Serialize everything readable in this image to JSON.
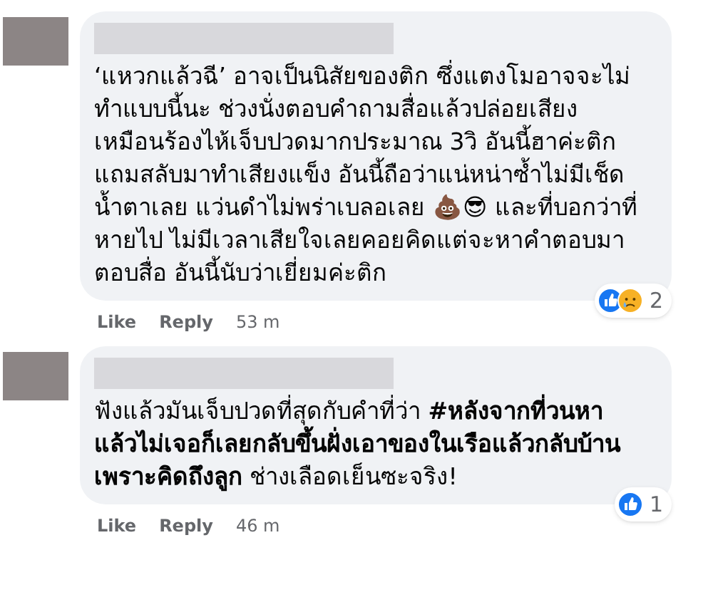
{
  "comments": [
    {
      "text": "‘แหวกแล้วฉี’ อาจเป็นนิสัยของติก ซึ่งแตงโมอาจจะไม่ทำแบบนี้นะ ช่วงนั่งตอบคำถามสื่อแล้วปล่อยเสียงเหมือนร้องไห้เจ็บปวดมากประมาณ 3วิ อันนี้ฮาค่ะติก แถมสลับมาทำเสียงแข็ง อันนี้ถือว่าแน่หน่าซ้ำไม่มีเช็ดน้ำตาเลย แว่นดำไม่พร่าเบลอเลย 💩😎 และที่บอกว่าที่หายไป ไม่มีเวลาเสียใจเลยคอยคิดแต่จะหาคำตอบมาตอบสื่อ อันนี้นับว่าเยี่ยมค่ะติก",
      "reactions": [
        {
          "kind": "like"
        },
        {
          "kind": "sad"
        }
      ],
      "reaction_count": "2",
      "actions": [
        "Like",
        "Reply"
      ],
      "time": "53 m"
    },
    {
      "text": "ฟังแล้วมันเจ็บปวดที่สุดกับคำที่ว่า **#หลังจากที่วนหาแล้วไม่เจอก็เลยกลับขึ้นฝั่งเอาของในเรือแล้วกลับบ้านเพราะคิดถึงลูก** ช่างเลือดเย็นซะจริง!",
      "reactions": [
        {
          "kind": "like"
        }
      ],
      "reaction_count": "1",
      "actions": [
        "Like",
        "Reply"
      ],
      "time": "46 m"
    }
  ]
}
